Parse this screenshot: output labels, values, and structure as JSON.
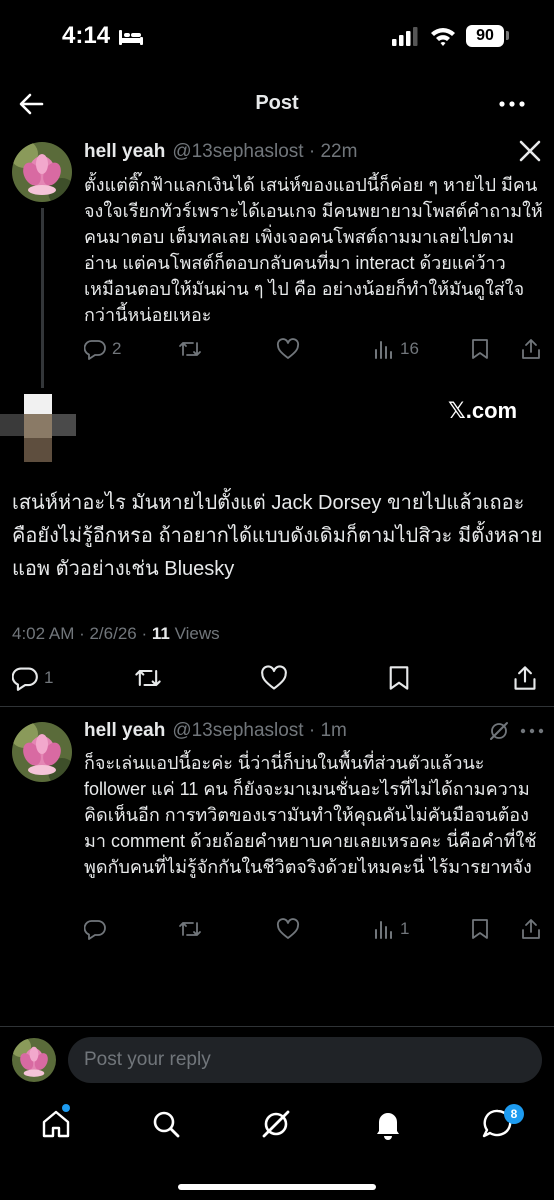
{
  "status_bar": {
    "time": "4:14",
    "battery": "90"
  },
  "header": {
    "title": "Post"
  },
  "parent_post": {
    "name": "hell yeah",
    "handle_time": "@13sephaslost · 22m",
    "text": "ตั้งแต่ติ๊กฟ้าแลกเงินได้ เสน่ห์ของแอปนี้ก็ค่อย ๆ หายไป มีคนจงใจเรียกทัวร์เพราะได้เอนเกจ มีคนพยายามโพสต์คำถามให้คนมาตอบ เต็มทลเลย เพิ่งเจอคนโพสต์ถามมาเลยไปตามอ่าน แต่คนโพสต์ก็ตอบกลับคนที่มา interact ด้วยแค่ว้าว เหมือนตอบให้มันผ่าน ๆ ไป คือ อย่างน้อยก็ทำให้มันดูใส่ใจกว่านี้หน่อยเหอะ",
    "replies": "2",
    "views": "16"
  },
  "main_post": {
    "source_label": "𝕏.com",
    "text": "เสน่ห์ห่าอะไร มันหายไปตั้งแต่ Jack Dorsey ขายไปแล้วเถอะ คือยังไม่รู้อีกหรอ ถ้าอยากได้แบบดังเดิมก็ตามไปสิวะ มีตั้งหลายแอพ ตัวอย่างเช่น Bluesky",
    "timestamp": "4:02 AM · 2/6/26 · ",
    "views_count": "11",
    "views_label": " Views",
    "replies": "1"
  },
  "reply_post": {
    "name": "hell yeah",
    "handle_time": "@13sephaslost · 1m",
    "text": "ก็จะเล่นแอปนี้อะค่ะ นี่ว่านี่ก็บ่นในพื้นที่ส่วนตัวแล้วนะ follower แค่ 11 คน ก็ยังจะมาเมนชั่นอะไรที่ไม่ได้ถามความคิดเห็นอีก การทวิตของเรามันทำให้คุณคันไม่คันมือจนต้องมา comment ด้วยถ้อยคำหยาบคายเลยเหรอคะ นี่คือคำที่ใช้พูดกับคนที่ไม่รู้จักกันในชีวิตจริงด้วยไหมคะนี่ ไร้มารยาทจัง",
    "views": "1"
  },
  "reply_bar": {
    "placeholder": "Post your reply"
  },
  "bottom_nav": {
    "messages_badge": "8"
  },
  "colors": {
    "background": "#000000",
    "accent": "#1d9bf0",
    "secondary_text": "#71767b"
  }
}
